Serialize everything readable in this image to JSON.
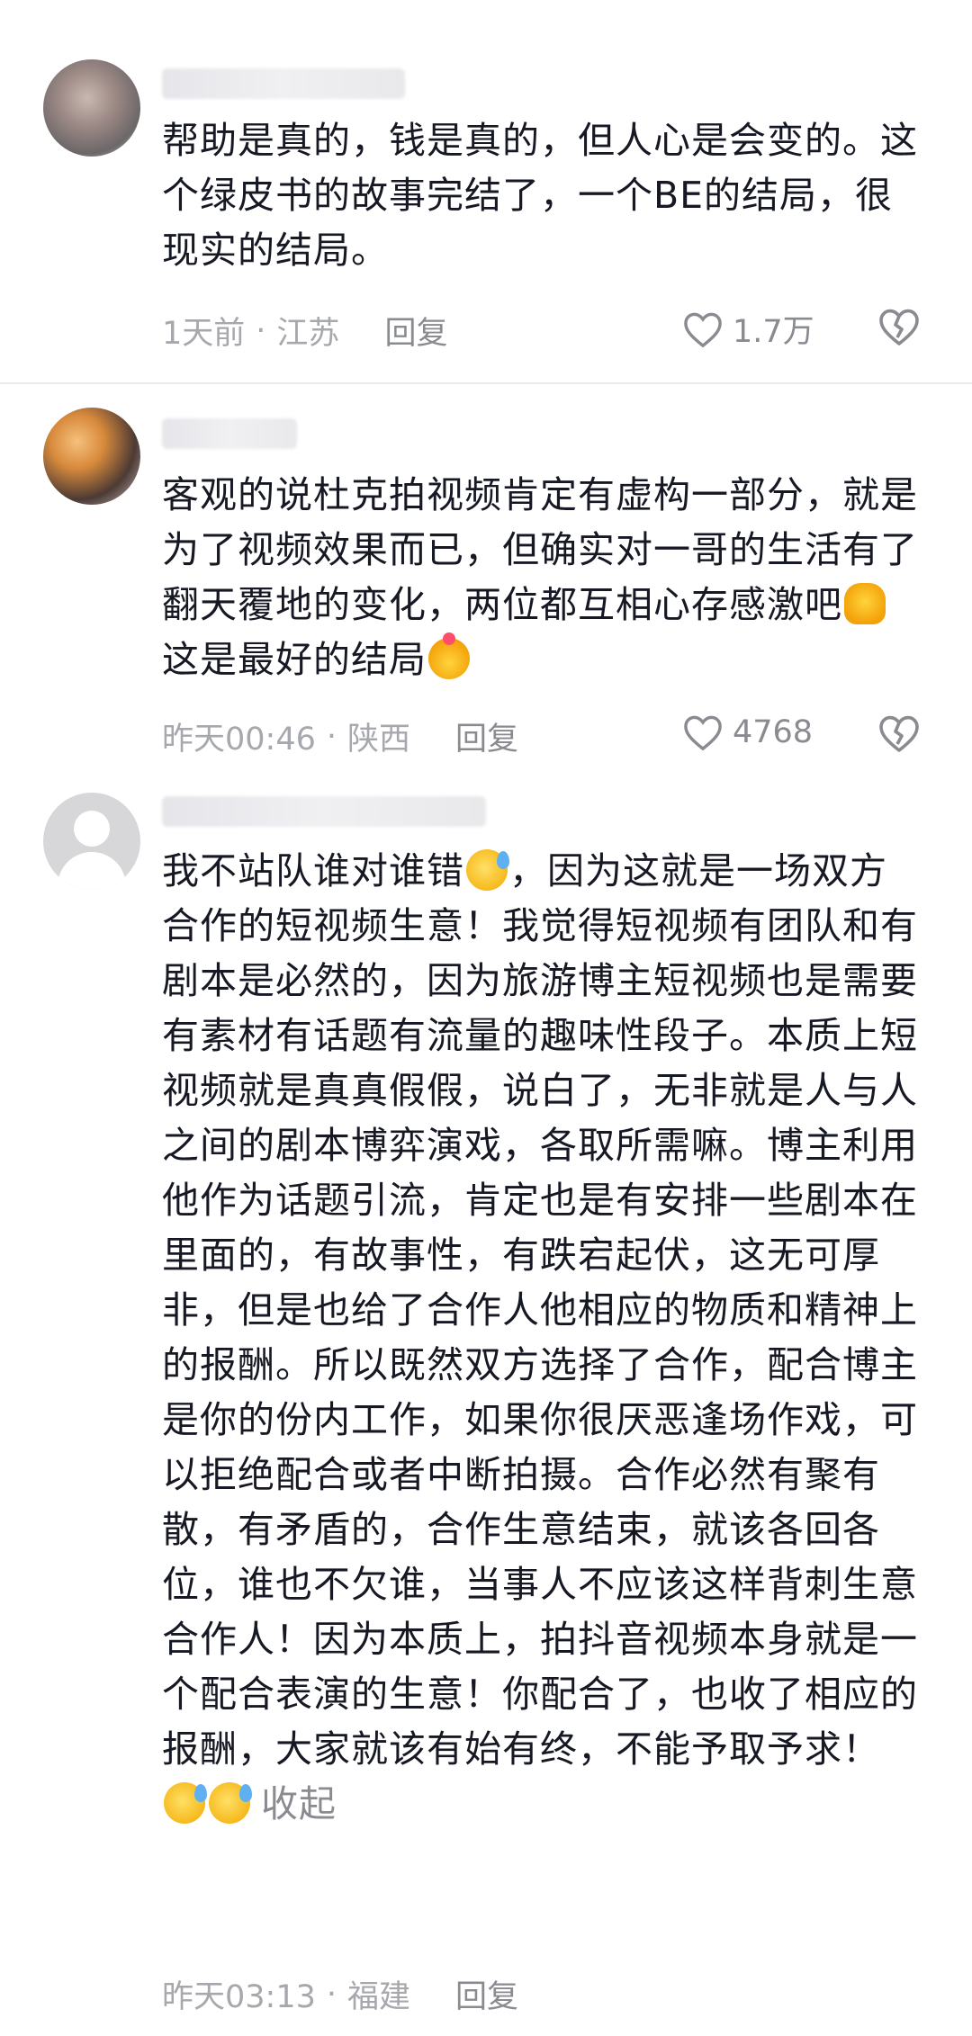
{
  "comments": [
    {
      "text": "帮助是真的，钱是真的，但人心是会变的。这个绿皮书的故事完结了，一个BE的结局，很现实的结局。",
      "time": "1天前",
      "location": "江苏",
      "reply_label": "回复",
      "likes": "1.7万"
    },
    {
      "text_parts": [
        "客观的说杜克拍视频肯定有虚构一部分，就是为了视频效果而已，但确实对一哥的生活有了翻天覆地的变化，两位都互相心存感激吧",
        "这是最好的结局"
      ],
      "time": "昨天00:46",
      "location": "陕西",
      "reply_label": "回复",
      "likes": "4768",
      "emojis": [
        "thumbs-up-emoji",
        "finger-heart-emoji"
      ]
    },
    {
      "text_parts": [
        "我不站队谁对谁错",
        "，因为这就是一场双方合作的短视频生意！我觉得短视频有团队和有剧本是必然的，因为旅游博主短视频也是需要有素材有话题有流量的趣味性段子。本质上短视频就是真真假假，说白了，无非就是人与人之间的剧本博弈演戏，各取所需嘛。博主利用他作为话题引流，肯定也是有安排一些剧本在里面的，有故事性，有跌宕起伏，这无可厚非，但是也给了合作人他相应的物质和精神上的报酬。所以既然双方选择了合作，配合博主是你的份内工作，如果你很厌恶逢场作戏，可以拒绝配合或者中断拍摄。合作必然有聚有散，有矛盾的，合作生意结束，就该各回各位，谁也不欠谁，当事人不应该这样背刺生意合作人！因为本质上，拍抖音视频本身就是一个配合表演的生意！你配合了，也收了相应的报酬，大家就该有始有终，不能予取予求！"
      ],
      "collapse_label": "收起",
      "time": "昨天03:13",
      "location": "福建",
      "reply_label": "回复",
      "emojis": [
        "sweat-smile-emoji"
      ]
    }
  ],
  "separator": "·"
}
